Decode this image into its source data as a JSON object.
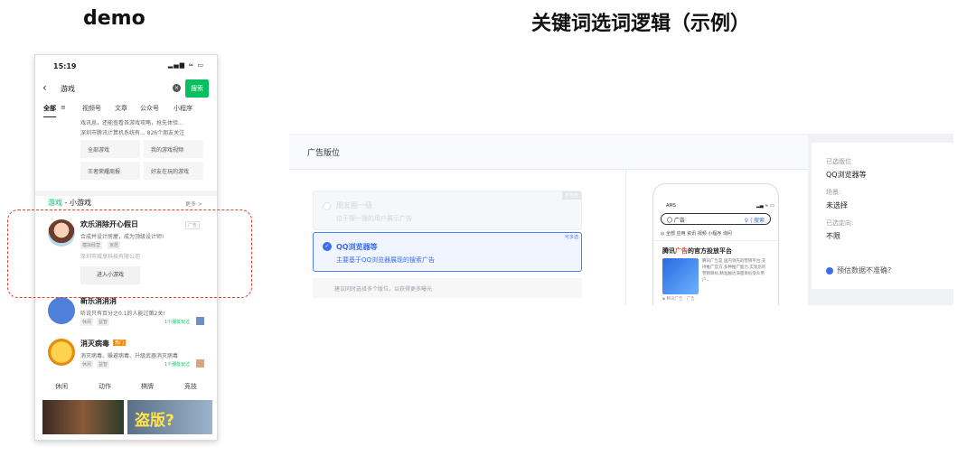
{
  "left_title": "demo",
  "right_title": "关键词选词逻辑（示例）",
  "phone": {
    "time": "15:19",
    "status_icons": "▂▄▆ ≈ ▭",
    "search_text": "游戏",
    "search_button": "搜索",
    "tabs": [
      "全部",
      "视频号",
      "文章",
      "公众号",
      "小程序"
    ],
    "info_line_1": "戏讯息，还能查看各游戏攻略，抢先体验...",
    "info_line_2": "深圳市腾讯计算机系统有...   826个朋友关注",
    "grid_buttons": [
      "全部游戏",
      "我的游戏视频",
      "王者荣耀周报",
      "好友在玩的游戏"
    ],
    "section_green": "游戏",
    "section_rest": " - 小游戏",
    "more_link": "更多 >",
    "game1": {
      "name": "欢乐消除开心假日",
      "desc": "合成并设计房屋，成为顶级设计师!",
      "chips": [
        "模拟经营",
        "家居"
      ],
      "company": "深圳市威享科技有限公司",
      "ad_tag": "广告",
      "enter_button": "进入小游戏"
    },
    "game2": {
      "name": "新乐消消消",
      "desc": "听说只有百分之0.1的人能过第2关!",
      "chips": [
        "休闲",
        "益智"
      ],
      "friends": "1个朋友玩过"
    },
    "game3": {
      "name": "消灭病毒",
      "tag": "热门",
      "desc": "消灭病毒、躲避病毒、升级武器消灭病毒",
      "chips": [
        "休闲",
        "益智"
      ],
      "friends": "1个朋友玩过"
    },
    "categories": [
      "休闲",
      "动作",
      "棋牌",
      "竞技"
    ],
    "banner_text": "盗版?"
  },
  "panel": {
    "header_title": "广告版位",
    "option1": {
      "title": "朋友圈一级",
      "desc": "位于搜一搜的用户展示广告",
      "badge": "不可选"
    },
    "option2": {
      "title": "QQ浏览器等",
      "desc": "主要基于QQ浏览器展现的搜索广告",
      "badge": "可多选"
    },
    "hint": "建议同时选择多个版位，以获得更多曝光",
    "mini_phone": {
      "time": "AMS",
      "status_icons": "▂▄ ≈ ▭",
      "search_text": "〇 广告",
      "search_button": "♀ | 搜索",
      "tabs": "◎ 全部  应用  资讯  视频  小程序  询问",
      "card_title_pre": "腾讯",
      "card_title_red": "广告",
      "card_title_post": "的官方投放平台",
      "desc": "腾讯广告是 国内领先的营销平台,支持推广官方,多种推广能力,实现您的营销目标,精准触达海量目标受众用户...",
      "footer": "▪ 腾讯广告 · 广告 ·"
    },
    "side": {
      "selected_label": "已选版位",
      "selected_value": "QQ浏览器等",
      "scene_label": "场景:",
      "scene_value": "未选择",
      "target_label": "已选定向:",
      "target_value": "不限",
      "hint": "预估数据不准确?"
    }
  },
  "colors": {
    "accent_green": "#07c160",
    "accent_blue": "#3d6de8",
    "dashed_red": "#e0402a"
  }
}
